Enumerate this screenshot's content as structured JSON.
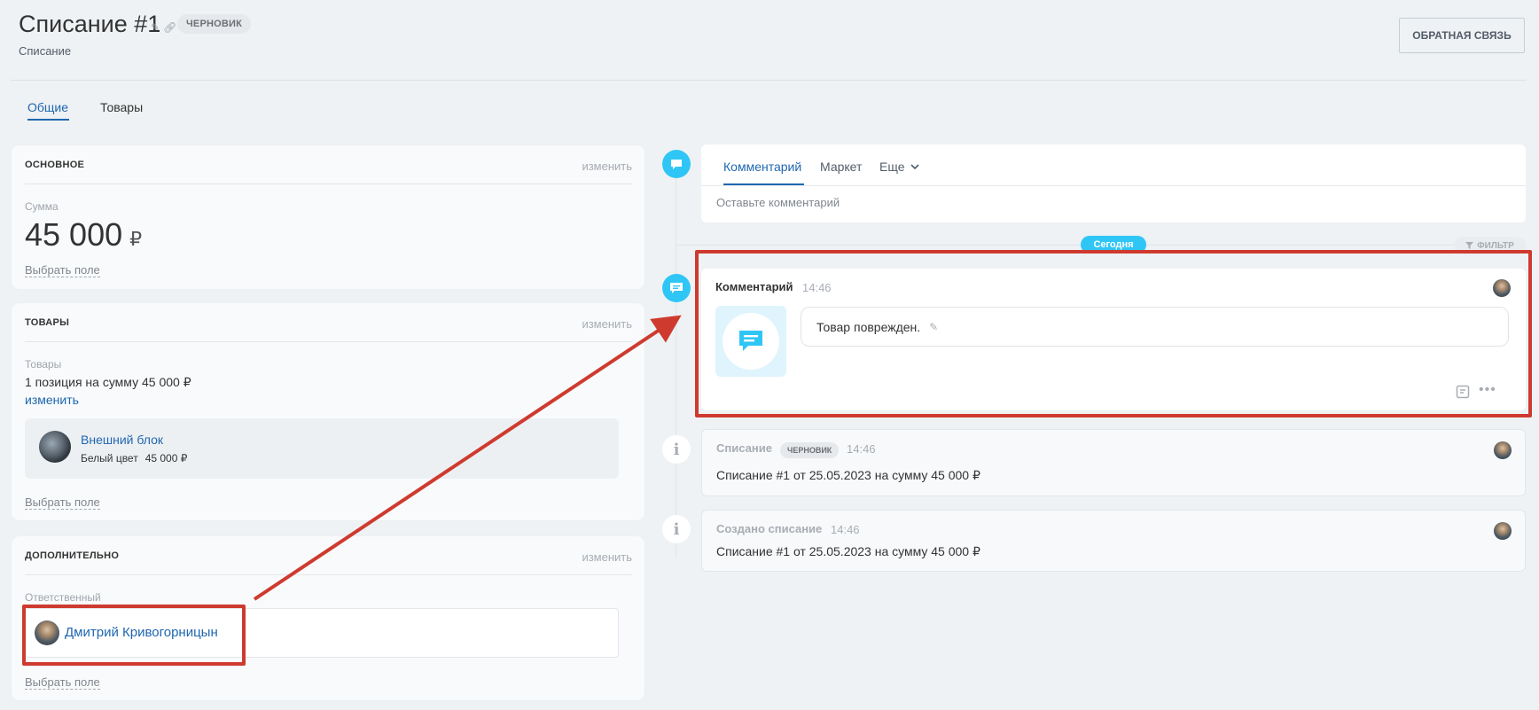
{
  "header": {
    "title": "Списание #1",
    "status_badge": "ЧЕРНОВИК",
    "subtitle": "Списание",
    "feedback_button": "ОБРАТНАЯ СВЯЗЬ"
  },
  "tabs": [
    {
      "label": "Общие",
      "active": true
    },
    {
      "label": "Товары",
      "active": false
    }
  ],
  "main_card": {
    "title": "ОСНОВНОЕ",
    "edit": "изменить",
    "sum_label": "Сумма",
    "sum_value": "45 000",
    "currency": "₽",
    "select_field": "Выбрать поле"
  },
  "goods_card": {
    "title": "ТОВАРЫ",
    "edit": "изменить",
    "label": "Товары",
    "summary": "1 позиция на сумму 45 000 ₽",
    "change_link": "изменить",
    "item_name": "Внешний блок",
    "item_color": "Белый цвет",
    "item_price": "45 000 ₽",
    "select_field": "Выбрать поле"
  },
  "extra_card": {
    "title": "ДОПОЛНИТЕЛЬНО",
    "edit": "изменить",
    "responsible_label": "Ответственный",
    "responsible_name": "Дмитрий Кривогорницын",
    "select_field": "Выбрать поле"
  },
  "composer": {
    "tabs": [
      "Комментарий",
      "Маркет",
      "Еще"
    ],
    "placeholder": "Оставьте комментарий"
  },
  "timeline": {
    "today": "Сегодня",
    "filter": "ФИЛЬТР",
    "comment": {
      "title": "Комментарий",
      "time": "14:46",
      "text": "Товар поврежден."
    },
    "writeoff": {
      "title": "Списание",
      "badge": "ЧЕРНОВИК",
      "time": "14:46",
      "text": "Списание #1 от 25.05.2023 на сумму 45 000 ₽"
    },
    "created": {
      "title": "Создано списание",
      "time": "14:46",
      "text": "Списание #1 от 25.05.2023 на сумму 45 000 ₽"
    }
  },
  "colors": {
    "accent": "#2067b0",
    "timeline_icon": "#2fc6f6",
    "annotation": "#cf3a2f"
  }
}
